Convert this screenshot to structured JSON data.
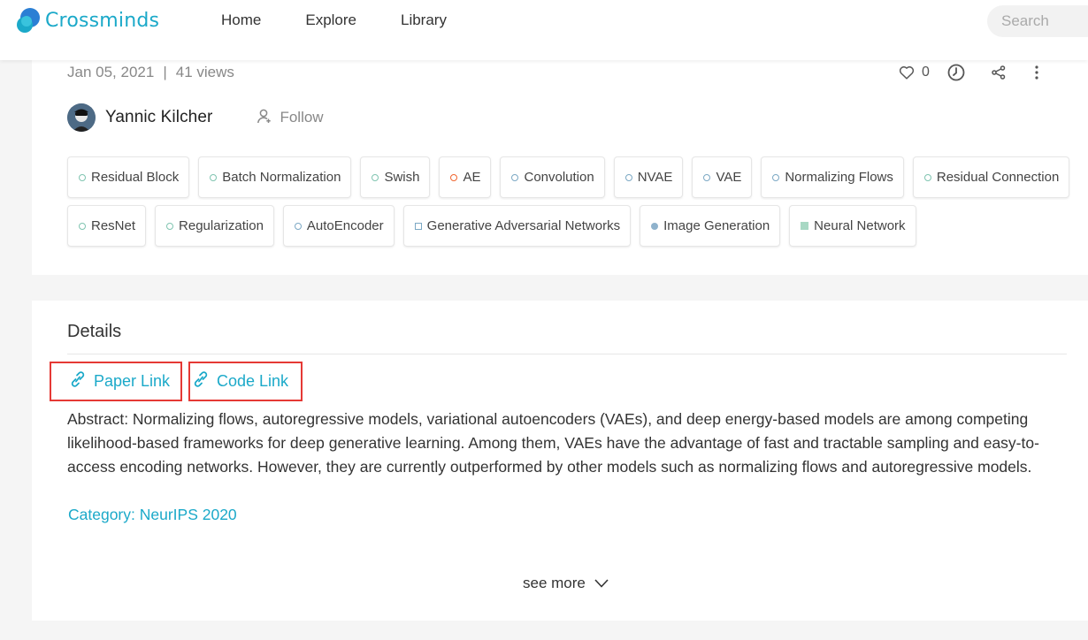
{
  "header": {
    "logo_text": "Crossminds",
    "nav": [
      "Home",
      "Explore",
      "Library"
    ],
    "search_placeholder": "Search"
  },
  "video": {
    "date": "Jan 05, 2021",
    "separator": "|",
    "views": "41 views",
    "like_count": "0"
  },
  "author": {
    "name": "Yannic Kilcher",
    "follow_label": "Follow"
  },
  "tags": {
    "row1": [
      {
        "label": "Residual Block",
        "color": "#7fc4b0",
        "shape": "ring"
      },
      {
        "label": "Batch Normalization",
        "color": "#7fc4b0",
        "shape": "ring"
      },
      {
        "label": "Swish",
        "color": "#7fc4b0",
        "shape": "ring"
      },
      {
        "label": "AE",
        "color": "#f0652f",
        "shape": "ring"
      },
      {
        "label": "Convolution",
        "color": "#7ba8c4",
        "shape": "ring"
      },
      {
        "label": "NVAE",
        "color": "#7ba8c4",
        "shape": "ring"
      },
      {
        "label": "VAE",
        "color": "#7ba8c4",
        "shape": "ring"
      },
      {
        "label": "Normalizing Flows",
        "color": "#7ba8c4",
        "shape": "ring"
      },
      {
        "label": "Residual Connection",
        "color": "#7fc4b0",
        "shape": "ring"
      }
    ],
    "row2": [
      {
        "label": "ResNet",
        "color": "#7fc4b0",
        "shape": "ring"
      },
      {
        "label": "Regularization",
        "color": "#7fc4b0",
        "shape": "ring"
      },
      {
        "label": "AutoEncoder",
        "color": "#7ba8c4",
        "shape": "ring"
      },
      {
        "label": "Generative Adversarial Networks",
        "color": "#7ba8c4",
        "shape": "square-outline"
      },
      {
        "label": "Image Generation",
        "color": "#8fb2cc",
        "shape": "dot"
      },
      {
        "label": "Neural Network",
        "color": "#a8d8c4",
        "shape": "square"
      }
    ]
  },
  "details": {
    "title": "Details",
    "paper_link": "Paper Link",
    "code_link": "Code Link",
    "abstract_lines": [
      "Abstract: Normalizing flows, autoregressive models, variational autoencoders (VAEs), and deep energy-based models are among competing",
      "likelihood-based frameworks for deep generative learning. Among them, VAEs have the advantage of fast and tractable sampling and easy-to-",
      "access encoding networks. However, they are currently outperformed by other models such as normalizing flows and autoregressive models."
    ],
    "category": "Category: NeurIPS 2020",
    "see_more": "see more"
  },
  "colors": {
    "accent": "#1ba9c9",
    "highlight_border": "#e53935"
  }
}
